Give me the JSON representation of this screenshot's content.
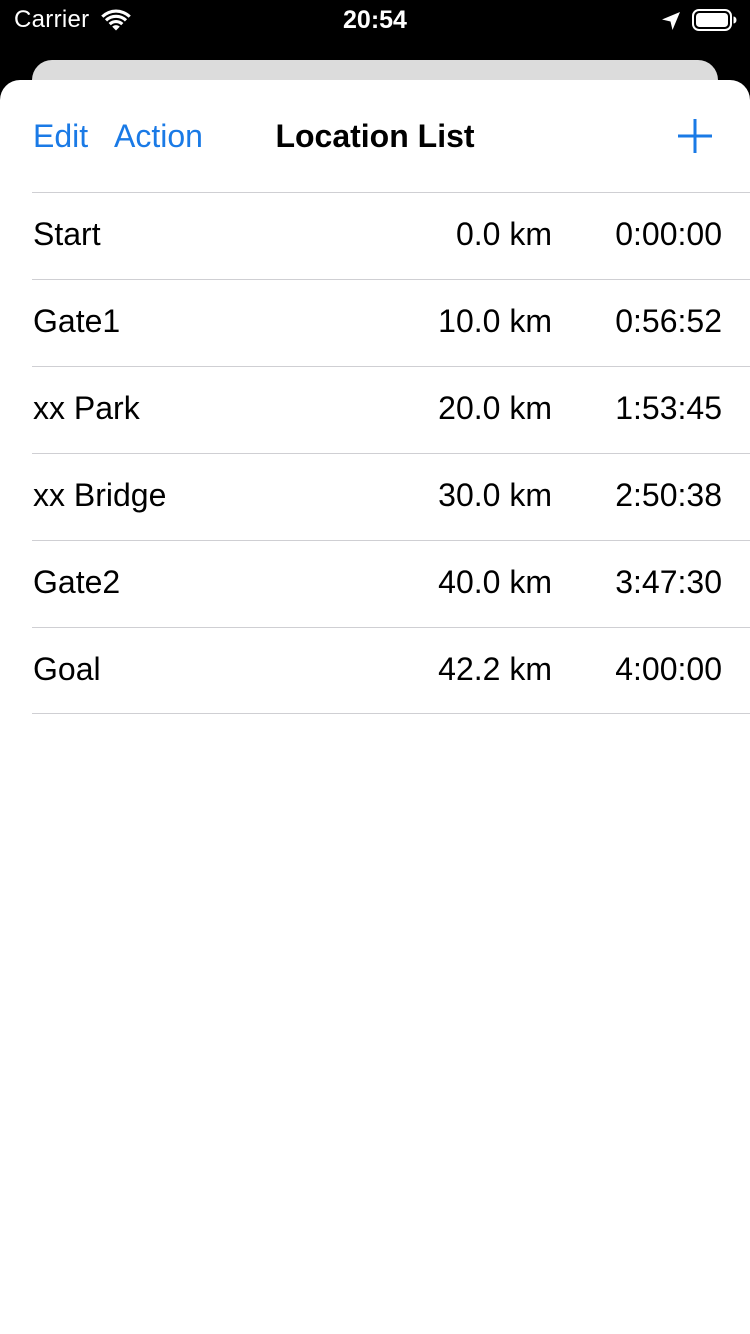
{
  "status_bar": {
    "carrier": "Carrier",
    "time": "20:54"
  },
  "nav": {
    "edit_label": "Edit",
    "action_label": "Action",
    "title": "Location List",
    "add_icon": "plus-icon"
  },
  "locations": [
    {
      "name": "Start",
      "distance": "0.0 km",
      "time": "0:00:00"
    },
    {
      "name": "Gate1",
      "distance": "10.0 km",
      "time": "0:56:52"
    },
    {
      "name": "xx Park",
      "distance": "20.0 km",
      "time": "1:53:45"
    },
    {
      "name": "xx Bridge",
      "distance": "30.0 km",
      "time": "2:50:38"
    },
    {
      "name": "Gate2",
      "distance": "40.0 km",
      "time": "3:47:30"
    },
    {
      "name": "Goal",
      "distance": "42.2 km",
      "time": "4:00:00"
    }
  ],
  "colors": {
    "accent": "#1a7ae6",
    "separator": "#cfcfd3",
    "status_bar_bg": "#000000"
  }
}
